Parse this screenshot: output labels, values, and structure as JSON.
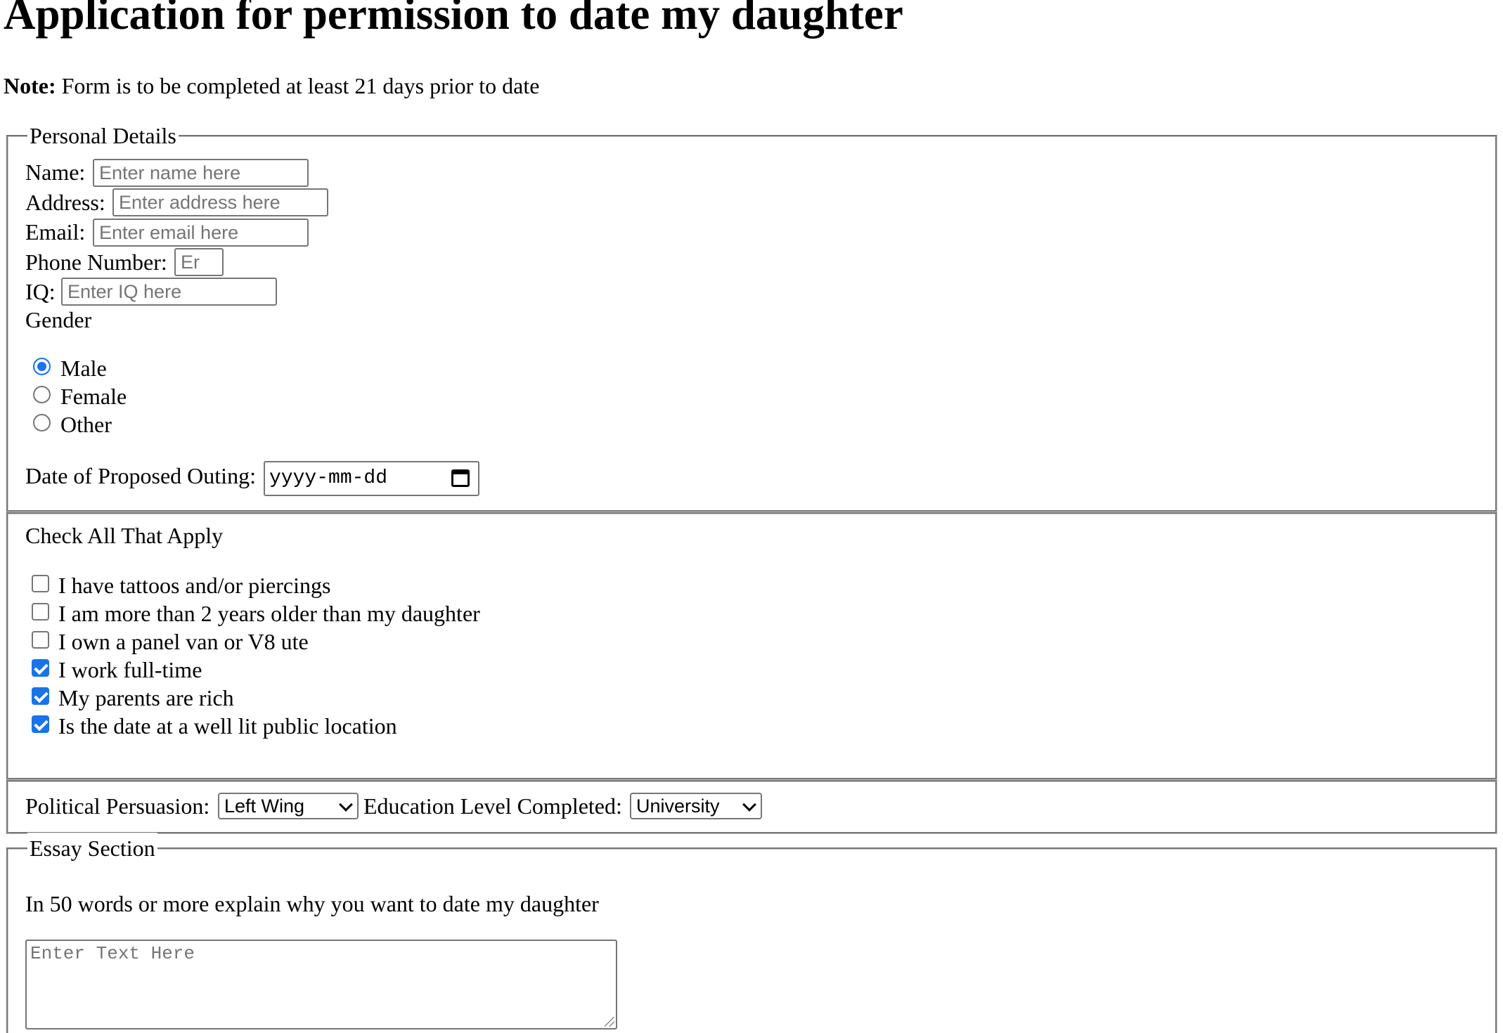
{
  "heading": "Application for permission to date my daughter",
  "note": {
    "label": "Note:",
    "text": " Form is to be completed at least 21 days prior to date"
  },
  "personal": {
    "legend": "Personal Details",
    "name_label": "Name:",
    "name_placeholder": "Enter name here",
    "address_label": "Address:",
    "address_placeholder": "Enter address here",
    "email_label": "Email:",
    "email_placeholder": "Enter email here",
    "phone_label": "Phone Number:",
    "phone_placeholder": "Er",
    "iq_label": "IQ:",
    "iq_placeholder": "Enter IQ here",
    "gender_label": "Gender",
    "gender_options": [
      {
        "label": "Male",
        "checked": true
      },
      {
        "label": "Female",
        "checked": false
      },
      {
        "label": "Other",
        "checked": false
      }
    ],
    "date_label": "Date of Proposed Outing:",
    "date_placeholder": "yyyy-mm-dd",
    "date_icon": "calendar-icon"
  },
  "checks": {
    "heading": "Check All That Apply",
    "items": [
      {
        "label": "I have tattoos and/or piercings",
        "checked": false
      },
      {
        "label": "I am more than 2 years older than my daughter",
        "checked": false
      },
      {
        "label": "I own a panel van or V8 ute",
        "checked": false
      },
      {
        "label": "I work full-time",
        "checked": true
      },
      {
        "label": "My parents are rich",
        "checked": true
      },
      {
        "label": "Is the date at a well lit public location",
        "checked": true
      }
    ]
  },
  "selects": {
    "political_label": "Political Persuasion:",
    "political_value": "Left Wing",
    "education_label": "Education Level Completed:",
    "education_value": "University"
  },
  "essay": {
    "legend": "Essay Section",
    "prompt": "In 50 words or more explain why you want to date my daughter",
    "placeholder": "Enter Text Here"
  },
  "colors": {
    "accent": "#1a73e8",
    "control_border": "#767676",
    "placeholder": "#757575"
  }
}
